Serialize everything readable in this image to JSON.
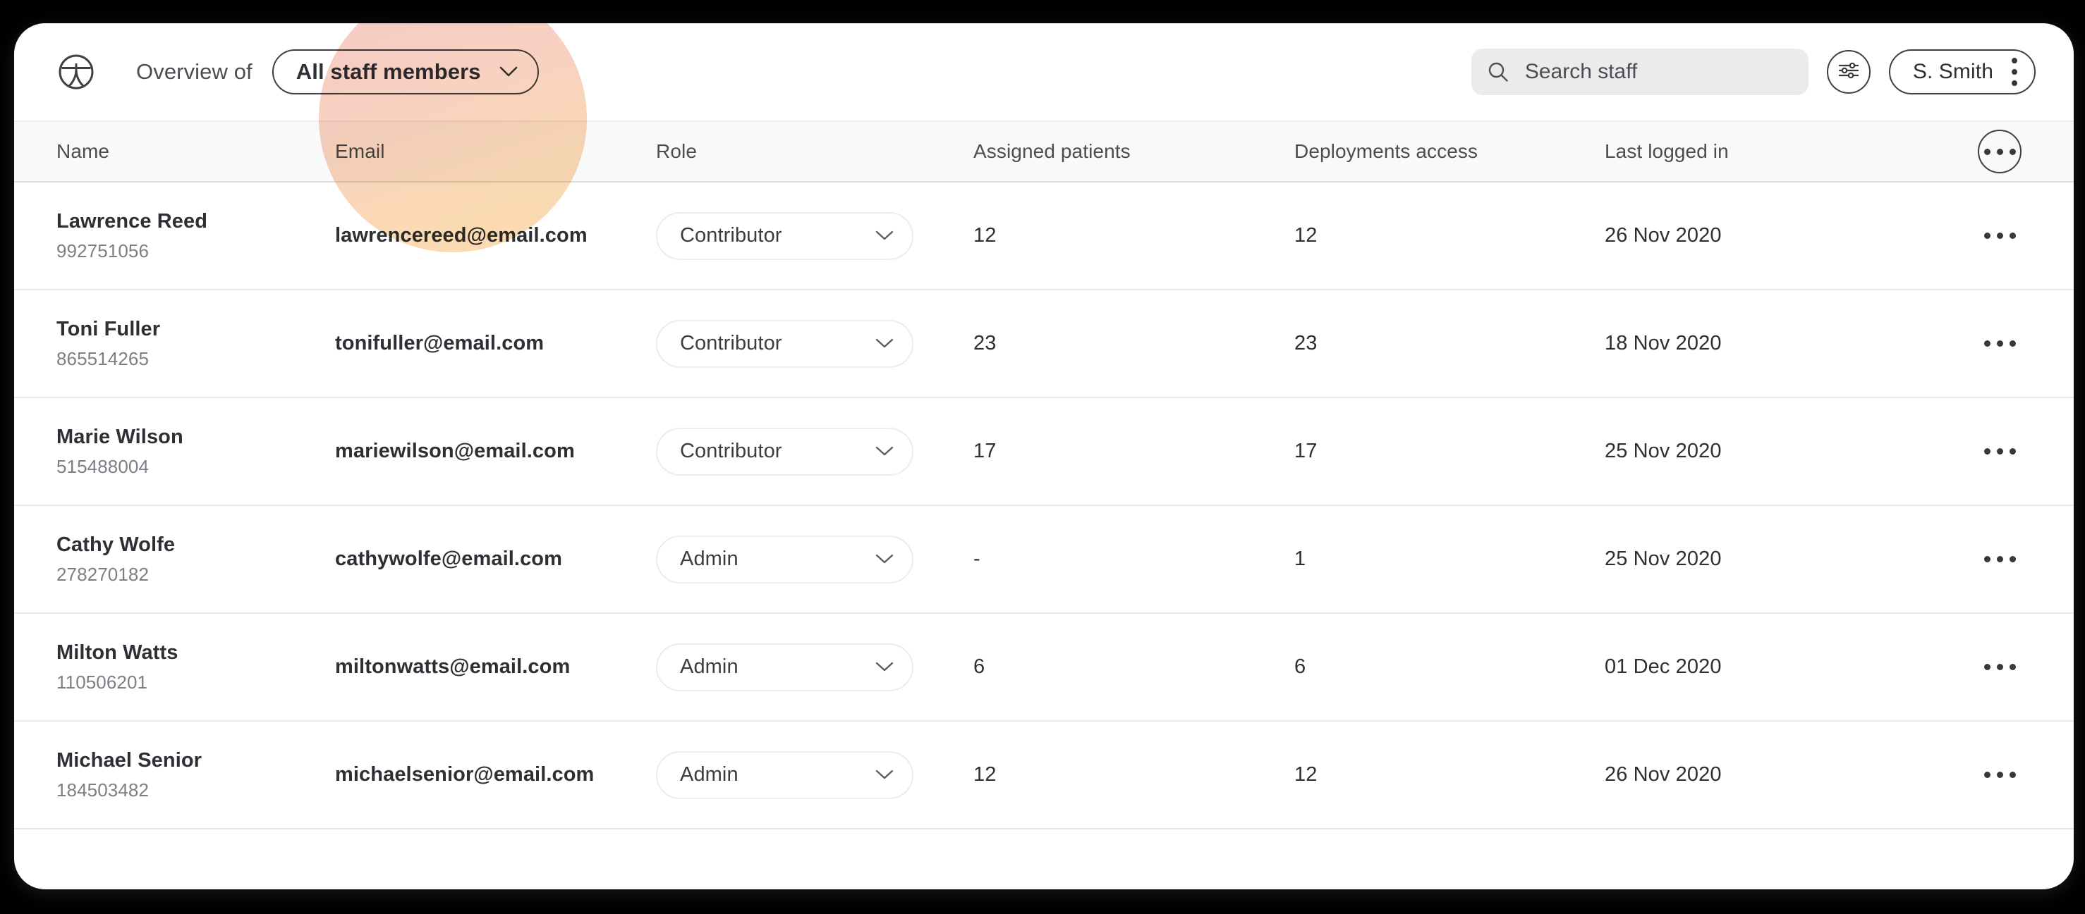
{
  "header": {
    "logo_icon": "people-circle-logo-icon",
    "overview_label": "Overview of",
    "scope_value": "All staff members",
    "scope_chevron_icon": "chevron-down-icon",
    "search": {
      "icon": "search-icon",
      "placeholder": "Search staff",
      "value": ""
    },
    "filter_icon": "sliders-filter-icon",
    "user": {
      "name": "S. Smith",
      "menu_icon": "vertical-dots-icon"
    }
  },
  "table": {
    "columns": [
      "Name",
      "Email",
      "Role",
      "Assigned patients",
      "Deployments access",
      "Last logged in"
    ],
    "header_actions_icon": "horizontal-dots-icon",
    "row_actions_icon": "horizontal-dots-icon",
    "role_chevron_icon": "chevron-down-icon",
    "rows": [
      {
        "name": "Lawrence Reed",
        "id": "992751056",
        "email": "lawrencereed@email.com",
        "role": "Contributor",
        "assigned_patients": "12",
        "deployments_access": "12",
        "last_logged_in": "26 Nov 2020"
      },
      {
        "name": "Toni Fuller",
        "id": "865514265",
        "email": "tonifuller@email.com",
        "role": "Contributor",
        "assigned_patients": "23",
        "deployments_access": "23",
        "last_logged_in": "18 Nov 2020"
      },
      {
        "name": "Marie Wilson",
        "id": "515488004",
        "email": "mariewilson@email.com",
        "role": "Contributor",
        "assigned_patients": "17",
        "deployments_access": "17",
        "last_logged_in": "25 Nov 2020"
      },
      {
        "name": "Cathy Wolfe",
        "id": "278270182",
        "email": "cathywolfe@email.com",
        "role": "Admin",
        "assigned_patients": "-",
        "deployments_access": "1",
        "last_logged_in": "25 Nov 2020"
      },
      {
        "name": "Milton Watts",
        "id": "110506201",
        "email": "miltonwatts@email.com",
        "role": "Admin",
        "assigned_patients": "6",
        "deployments_access": "6",
        "last_logged_in": "01 Dec 2020"
      },
      {
        "name": "Michael Senior",
        "id": "184503482",
        "email": "michaelsenior@email.com",
        "role": "Admin",
        "assigned_patients": "12",
        "deployments_access": "12",
        "last_logged_in": "26 Nov 2020"
      }
    ]
  },
  "colors": {
    "page_background": "#000000",
    "card_background": "#ffffff",
    "header_row_background": "#f9f9f9",
    "search_background": "#ebebeb",
    "text_primary": "#2c2f34",
    "text_secondary": "#7c7f85",
    "border": "#e9e9ea",
    "highlight_pink": "#f4c5c0",
    "highlight_orange": "#fbd9a8"
  }
}
